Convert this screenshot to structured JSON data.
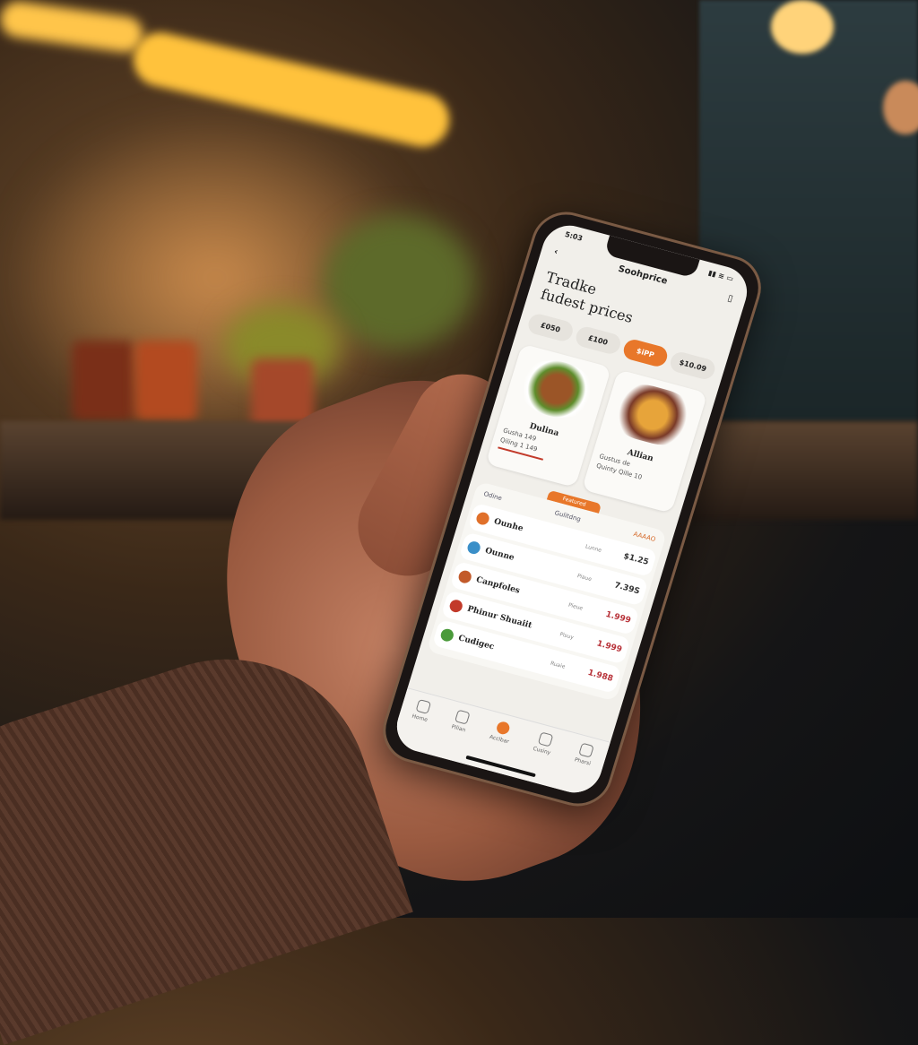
{
  "status": {
    "time": "5:03"
  },
  "header": {
    "title": "Soohprice"
  },
  "headline": [
    "Tradke",
    "fudest prices"
  ],
  "chips": [
    {
      "label": "£050",
      "active": false
    },
    {
      "label": "£100",
      "active": false
    },
    {
      "label": "$iPP",
      "active": true
    },
    {
      "label": "$10.09",
      "active": false
    }
  ],
  "cards": [
    {
      "name": "Dulina",
      "line1": "Gusha 149",
      "line2": "Qiling 1 149"
    },
    {
      "name": "Allian",
      "line1": "Gustus de",
      "line2": "Quinty Qille 10"
    }
  ],
  "featured_tag": "Featured",
  "list": {
    "header_left": "Odine",
    "header_mid": "Gulitdng",
    "header_right": "AAAAO",
    "rows": [
      {
        "name": "Ounhe",
        "sub": "Lunne",
        "price": "$1.25",
        "icon_color": "#e0702a",
        "red": false
      },
      {
        "name": "Ounne",
        "sub": "Piaue",
        "price": "7.39S",
        "icon_color": "#3a8fc8",
        "red": false
      },
      {
        "name": "Canpfoles",
        "sub": "Pieue",
        "price": "1.999",
        "icon_color": "#c25a2a",
        "red": true
      },
      {
        "name": "Phinur Shuaiit",
        "sub": "Pisuy",
        "price": "1.999",
        "icon_color": "#c23a2a",
        "red": true
      },
      {
        "name": "Cudigec",
        "sub": "Ruaie",
        "price": "1.988",
        "icon_color": "#4a9a3a",
        "red": true
      }
    ]
  },
  "nav": [
    {
      "label": "Home",
      "icon": "home-icon"
    },
    {
      "label": "Pilian",
      "icon": "globe-icon"
    },
    {
      "label": "Acclbar",
      "icon": "orange-circle-icon",
      "active": true
    },
    {
      "label": "Cusiny",
      "icon": "shield-icon"
    },
    {
      "label": "Pharsi",
      "icon": "search-icon"
    }
  ],
  "colors": {
    "accent": "#e8772a",
    "price_red": "#b8333a"
  }
}
